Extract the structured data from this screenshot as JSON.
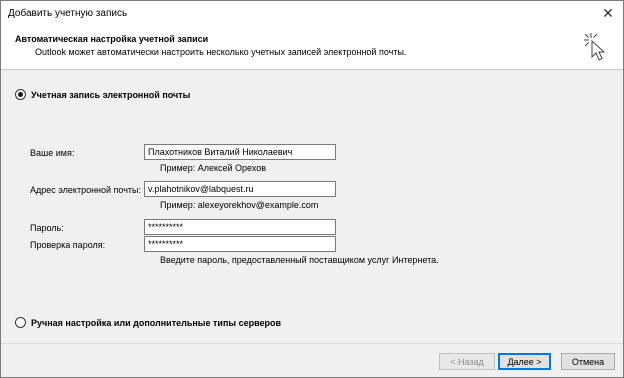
{
  "window": {
    "title": "Добавить учетную запись",
    "close_glyph": "✕"
  },
  "header": {
    "title": "Автоматическая настройка учетной записи",
    "subtitle": "Outlook может автоматически настроить несколько учетных записей электронной почты.",
    "icon": "wizard-wand-icon"
  },
  "options": {
    "email_account": {
      "label": "Учетная запись электронной почты",
      "selected": true
    },
    "manual": {
      "label": "Ручная настройка или дополнительные типы серверов",
      "selected": false
    }
  },
  "form": {
    "name": {
      "label": "Ваше имя:",
      "value": "Плахотников Виталий Николаевич",
      "hint": "Пример: Алексей Орехов"
    },
    "email": {
      "label": "Адрес электронной почты:",
      "value": "v.plahotnikov@labquest.ru",
      "hint": "Пример: alexeyorekhov@example.com"
    },
    "password": {
      "label": "Пароль:",
      "value": "**********"
    },
    "password_confirm": {
      "label": "Проверка пароля:",
      "value": "**********",
      "hint": "Введите пароль, предоставленный поставщиком услуг Интернета."
    }
  },
  "buttons": {
    "back": "< Назад",
    "next": "Далее >",
    "cancel": "Отмена"
  },
  "colors": {
    "accent": "#0078d7",
    "background": "#f0f0f0",
    "header_bg": "#ffffff"
  }
}
